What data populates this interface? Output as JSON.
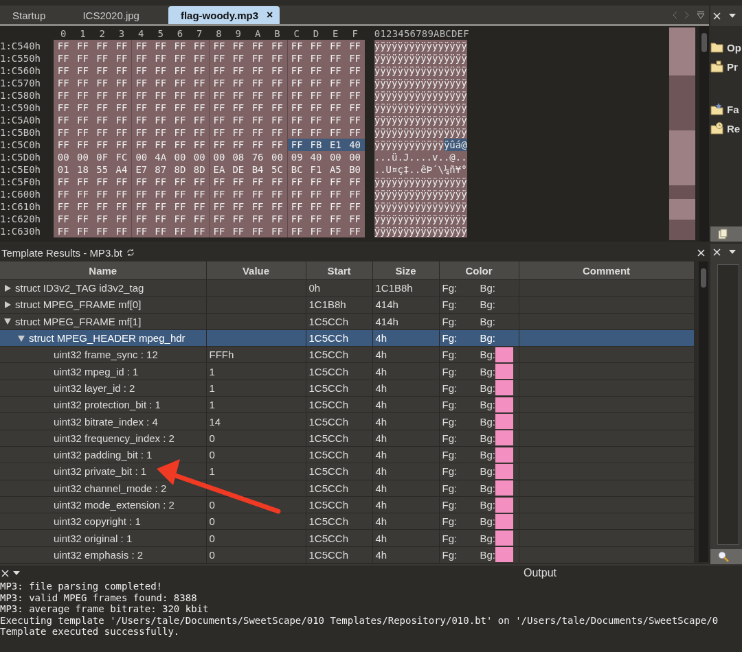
{
  "tabs": [
    {
      "label": "Startup",
      "selected": false
    },
    {
      "label": "ICS2020.jpg",
      "selected": false
    },
    {
      "label": "flag-woody.mp3",
      "selected": true,
      "close": "×"
    }
  ],
  "hex": {
    "columns": [
      "0",
      "1",
      "2",
      "3",
      "4",
      "5",
      "6",
      "7",
      "8",
      "9",
      "A",
      "B",
      "C",
      "D",
      "E",
      "F"
    ],
    "ascii_header": "0123456789ABCDEF",
    "rows": [
      {
        "address": "1:C540h",
        "segments": [
          {
            "bytes": [
              "FF",
              "FF",
              "FF",
              "FF",
              "FF",
              "FF",
              "FF",
              "FF",
              "FF",
              "FF",
              "FF",
              "FF",
              "FF",
              "FF",
              "FF",
              "FF"
            ],
            "ascii": "ÿÿÿÿÿÿÿÿÿÿÿÿÿÿÿÿ",
            "selected": false
          }
        ]
      },
      {
        "address": "1:C550h",
        "segments": [
          {
            "bytes": [
              "FF",
              "FF",
              "FF",
              "FF",
              "FF",
              "FF",
              "FF",
              "FF",
              "FF",
              "FF",
              "FF",
              "FF",
              "FF",
              "FF",
              "FF",
              "FF"
            ],
            "ascii": "ÿÿÿÿÿÿÿÿÿÿÿÿÿÿÿÿ",
            "selected": false
          }
        ]
      },
      {
        "address": "1:C560h",
        "segments": [
          {
            "bytes": [
              "FF",
              "FF",
              "FF",
              "FF",
              "FF",
              "FF",
              "FF",
              "FF",
              "FF",
              "FF",
              "FF",
              "FF",
              "FF",
              "FF",
              "FF",
              "FF"
            ],
            "ascii": "ÿÿÿÿÿÿÿÿÿÿÿÿÿÿÿÿ",
            "selected": false
          }
        ]
      },
      {
        "address": "1:C570h",
        "segments": [
          {
            "bytes": [
              "FF",
              "FF",
              "FF",
              "FF",
              "FF",
              "FF",
              "FF",
              "FF",
              "FF",
              "FF",
              "FF",
              "FF",
              "FF",
              "FF",
              "FF",
              "FF"
            ],
            "ascii": "ÿÿÿÿÿÿÿÿÿÿÿÿÿÿÿÿ",
            "selected": false
          }
        ]
      },
      {
        "address": "1:C580h",
        "segments": [
          {
            "bytes": [
              "FF",
              "FF",
              "FF",
              "FF",
              "FF",
              "FF",
              "FF",
              "FF",
              "FF",
              "FF",
              "FF",
              "FF",
              "FF",
              "FF",
              "FF",
              "FF"
            ],
            "ascii": "ÿÿÿÿÿÿÿÿÿÿÿÿÿÿÿÿ",
            "selected": false
          }
        ]
      },
      {
        "address": "1:C590h",
        "segments": [
          {
            "bytes": [
              "FF",
              "FF",
              "FF",
              "FF",
              "FF",
              "FF",
              "FF",
              "FF",
              "FF",
              "FF",
              "FF",
              "FF",
              "FF",
              "FF",
              "FF",
              "FF"
            ],
            "ascii": "ÿÿÿÿÿÿÿÿÿÿÿÿÿÿÿÿ",
            "selected": false
          }
        ]
      },
      {
        "address": "1:C5A0h",
        "segments": [
          {
            "bytes": [
              "FF",
              "FF",
              "FF",
              "FF",
              "FF",
              "FF",
              "FF",
              "FF",
              "FF",
              "FF",
              "FF",
              "FF",
              "FF",
              "FF",
              "FF",
              "FF"
            ],
            "ascii": "ÿÿÿÿÿÿÿÿÿÿÿÿÿÿÿÿ",
            "selected": false
          }
        ]
      },
      {
        "address": "1:C5B0h",
        "segments": [
          {
            "bytes": [
              "FF",
              "FF",
              "FF",
              "FF",
              "FF",
              "FF",
              "FF",
              "FF",
              "FF",
              "FF",
              "FF",
              "FF",
              "FF",
              "FF",
              "FF",
              "FF"
            ],
            "ascii": "ÿÿÿÿÿÿÿÿÿÿÿÿÿÿÿÿ",
            "selected": false
          }
        ]
      },
      {
        "address": "1:C5C0h",
        "segments": [
          {
            "bytes": [
              "FF",
              "FF",
              "FF",
              "FF",
              "FF",
              "FF",
              "FF",
              "FF",
              "FF",
              "FF",
              "FF",
              "FF"
            ],
            "ascii": "ÿÿÿÿÿÿÿÿÿÿÿÿ",
            "selected": false
          },
          {
            "bytes": [
              "FF",
              "FB",
              "E1",
              "40"
            ],
            "ascii": "ÿûá@",
            "selected": true
          }
        ]
      },
      {
        "address": "1:C5D0h",
        "segments": [
          {
            "bytes": [
              "00",
              "00",
              "0F",
              "FC",
              "00",
              "4A",
              "00",
              "00",
              "00",
              "08",
              "76",
              "00",
              "09",
              "40",
              "00",
              "00"
            ],
            "ascii": "...ü.J....v..@..",
            "selected": false
          }
        ]
      },
      {
        "address": "1:C5E0h",
        "segments": [
          {
            "bytes": [
              "01",
              "18",
              "55",
              "A4",
              "E7",
              "87",
              "8D",
              "8D",
              "EA",
              "DE",
              "B4",
              "5C",
              "BC",
              "F1",
              "A5",
              "B0"
            ],
            "ascii": "..U¤ç‡..êÞ´\\¼ñ¥°",
            "selected": false
          }
        ]
      },
      {
        "address": "1:C5F0h",
        "segments": [
          {
            "bytes": [
              "FF",
              "FF",
              "FF",
              "FF",
              "FF",
              "FF",
              "FF",
              "FF",
              "FF",
              "FF",
              "FF",
              "FF",
              "FF",
              "FF",
              "FF",
              "FF"
            ],
            "ascii": "ÿÿÿÿÿÿÿÿÿÿÿÿÿÿÿÿ",
            "selected": false
          }
        ]
      },
      {
        "address": "1:C600h",
        "segments": [
          {
            "bytes": [
              "FF",
              "FF",
              "FF",
              "FF",
              "FF",
              "FF",
              "FF",
              "FF",
              "FF",
              "FF",
              "FF",
              "FF",
              "FF",
              "FF",
              "FF",
              "FF"
            ],
            "ascii": "ÿÿÿÿÿÿÿÿÿÿÿÿÿÿÿÿ",
            "selected": false
          }
        ]
      },
      {
        "address": "1:C610h",
        "segments": [
          {
            "bytes": [
              "FF",
              "FF",
              "FF",
              "FF",
              "FF",
              "FF",
              "FF",
              "FF",
              "FF",
              "FF",
              "FF",
              "FF",
              "FF",
              "FF",
              "FF",
              "FF"
            ],
            "ascii": "ÿÿÿÿÿÿÿÿÿÿÿÿÿÿÿÿ",
            "selected": false
          }
        ]
      },
      {
        "address": "1:C620h",
        "segments": [
          {
            "bytes": [
              "FF",
              "FF",
              "FF",
              "FF",
              "FF",
              "FF",
              "FF",
              "FF",
              "FF",
              "FF",
              "FF",
              "FF",
              "FF",
              "FF",
              "FF",
              "FF"
            ],
            "ascii": "ÿÿÿÿÿÿÿÿÿÿÿÿÿÿÿÿ",
            "selected": false
          }
        ]
      },
      {
        "address": "1:C630h",
        "segments": [
          {
            "bytes": [
              "FF",
              "FF",
              "FF",
              "FF",
              "FF",
              "FF",
              "FF",
              "FF",
              "FF",
              "FF",
              "FF",
              "FF",
              "FF",
              "FF",
              "FF",
              "FF"
            ],
            "ascii": "ÿÿÿÿÿÿÿÿÿÿÿÿÿÿÿÿ",
            "selected": false
          }
        ]
      }
    ]
  },
  "side_panel": {
    "items": [
      {
        "label": "Op",
        "kind": "folder"
      },
      {
        "label": "Pr",
        "kind": "project"
      },
      {
        "label": "Fa",
        "kind": "favorite"
      },
      {
        "label": "Re",
        "kind": "recent"
      }
    ]
  },
  "template_results": {
    "title": "Template Results - MP3.bt",
    "columns": [
      "Name",
      "Value",
      "Start",
      "Size",
      "Color",
      "Comment"
    ],
    "rows": [
      {
        "name": "struct ID3v2_TAG id3v2_tag",
        "start": "0h",
        "size": "1C1B8h",
        "fg": "Fg:",
        "bg": "Bg:",
        "expanded": false,
        "selected": false
      },
      {
        "name": "struct MPEG_FRAME mf[0]",
        "start": "1C1B8h",
        "size": "414h",
        "fg": "Fg:",
        "bg": "Bg:",
        "expanded": false,
        "selected": false
      },
      {
        "name": "struct MPEG_FRAME mf[1]",
        "start": "1C5CCh",
        "size": "414h",
        "fg": "Fg:",
        "bg": "Bg:",
        "expanded": true,
        "selected": false,
        "children": [
          {
            "name": "struct MPEG_HEADER mpeg_hdr",
            "start": "1C5CCh",
            "size": "4h",
            "fg": "Fg:",
            "bg": "Bg:",
            "expanded": true,
            "selected": true,
            "children": [
              {
                "name": "uint32 frame_sync : 12",
                "value": "FFFh",
                "start": "1C5CCh",
                "size": "4h",
                "fg": "Fg:",
                "bg": "Bg:",
                "color": "#f48fc1",
                "selected": false
              },
              {
                "name": "uint32 mpeg_id : 1",
                "value": "1",
                "start": "1C5CCh",
                "size": "4h",
                "fg": "Fg:",
                "bg": "Bg:",
                "color": "#f48fc1",
                "selected": false
              },
              {
                "name": "uint32 layer_id : 2",
                "value": "1",
                "start": "1C5CCh",
                "size": "4h",
                "fg": "Fg:",
                "bg": "Bg:",
                "color": "#f48fc1",
                "selected": false
              },
              {
                "name": "uint32 protection_bit : 1",
                "value": "1",
                "start": "1C5CCh",
                "size": "4h",
                "fg": "Fg:",
                "bg": "Bg:",
                "color": "#f48fc1",
                "selected": false
              },
              {
                "name": "uint32 bitrate_index : 4",
                "value": "14",
                "start": "1C5CCh",
                "size": "4h",
                "fg": "Fg:",
                "bg": "Bg:",
                "color": "#f48fc1",
                "selected": false
              },
              {
                "name": "uint32 frequency_index : 2",
                "value": "0",
                "start": "1C5CCh",
                "size": "4h",
                "fg": "Fg:",
                "bg": "Bg:",
                "color": "#f48fc1",
                "selected": false
              },
              {
                "name": "uint32 padding_bit : 1",
                "value": "0",
                "start": "1C5CCh",
                "size": "4h",
                "fg": "Fg:",
                "bg": "Bg:",
                "color": "#f48fc1",
                "selected": false
              },
              {
                "name": "uint32 private_bit : 1",
                "value": "1",
                "start": "1C5CCh",
                "size": "4h",
                "fg": "Fg:",
                "bg": "Bg:",
                "color": "#f48fc1",
                "selected": false
              },
              {
                "name": "uint32 channel_mode : 2",
                "start": "1C5CCh",
                "size": "4h",
                "fg": "Fg:",
                "bg": "Bg:",
                "color": "#f48fc1",
                "selected": false
              },
              {
                "name": "uint32 mode_extension : 2",
                "value": "0",
                "start": "1C5CCh",
                "size": "4h",
                "fg": "Fg:",
                "bg": "Bg:",
                "color": "#f48fc1",
                "selected": false
              },
              {
                "name": "uint32 copyright : 1",
                "value": "0",
                "start": "1C5CCh",
                "size": "4h",
                "fg": "Fg:",
                "bg": "Bg:",
                "color": "#f48fc1",
                "selected": false
              },
              {
                "name": "uint32 original : 1",
                "value": "0",
                "start": "1C5CCh",
                "size": "4h",
                "fg": "Fg:",
                "bg": "Bg:",
                "color": "#f48fc1",
                "selected": false
              },
              {
                "name": "uint32 emphasis : 2",
                "value": "0",
                "start": "1C5CCh",
                "size": "4h",
                "fg": "Fg:",
                "bg": "Bg:",
                "color": "#f48fc1",
                "selected": false
              }
            ]
          }
        ]
      }
    ]
  },
  "output": {
    "title": "Output",
    "lines": [
      "MP3: file parsing completed!",
      "MP3: valid MPEG frames found: 8388",
      "MP3: average frame bitrate: 320 kbit",
      "Executing template '/Users/tale/Documents/SweetScape/010 Templates/Repository/010.bt' on '/Users/tale/Documents/SweetScape/0",
      "Template executed successfully."
    ]
  }
}
